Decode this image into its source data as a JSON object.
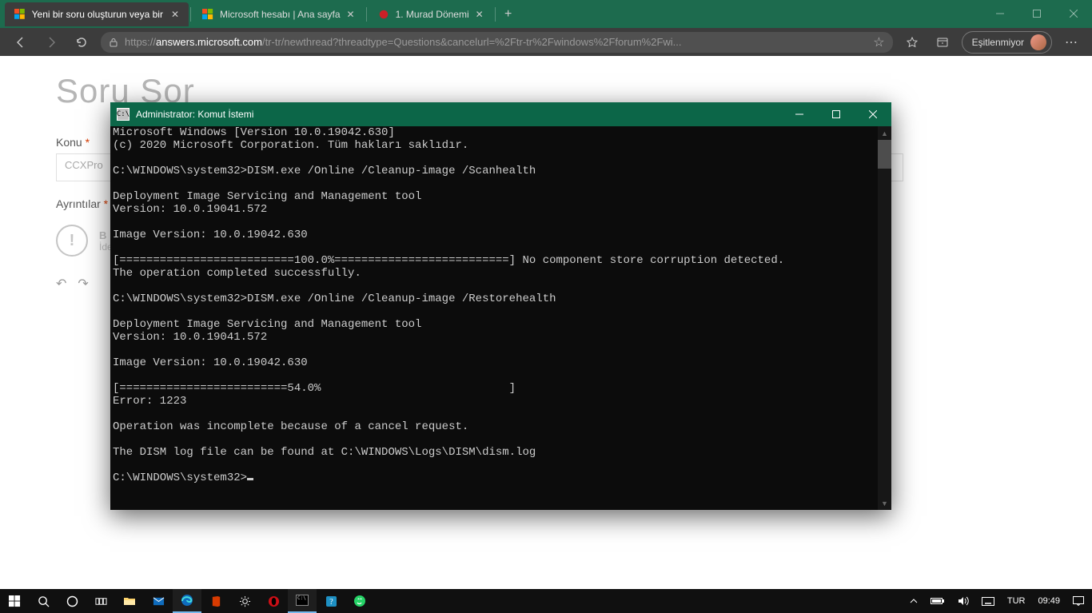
{
  "browser": {
    "tabs": [
      {
        "title": "Yeni bir soru oluşturun veya bir t",
        "favicon": "ms-logo",
        "active": true
      },
      {
        "title": "Microsoft hesabı | Ana sayfa",
        "favicon": "ms-logo",
        "active": false
      },
      {
        "title": "1. Murad Dönemi",
        "favicon": "red-dot",
        "active": false
      }
    ],
    "url_prefix": "https://",
    "url_host": "answers.microsoft.com",
    "url_path": "/tr-tr/newthread?threadtype=Questions&cancelurl=%2Ftr-tr%2Fwindows%2Fforum%2Fwi...",
    "profile_label": "Eşitlenmiyor"
  },
  "page": {
    "heading": "Soru Sor",
    "topic_label": "Konu",
    "topic_placeholder": "CCXPro",
    "details_label": "Ayrıntılar",
    "hint_letter": "B",
    "hint_text": "İde"
  },
  "cmd": {
    "title": "Administrator: Komut İstemi",
    "lines": [
      "Microsoft Windows [Version 10.0.19042.630]",
      "(c) 2020 Microsoft Corporation. Tüm hakları saklıdır.",
      "",
      "C:\\WINDOWS\\system32>DISM.exe /Online /Cleanup-image /Scanhealth",
      "",
      "Deployment Image Servicing and Management tool",
      "Version: 10.0.19041.572",
      "",
      "Image Version: 10.0.19042.630",
      "",
      "[==========================100.0%==========================] No component store corruption detected.",
      "The operation completed successfully.",
      "",
      "C:\\WINDOWS\\system32>DISM.exe /Online /Cleanup-image /Restorehealth",
      "",
      "Deployment Image Servicing and Management tool",
      "Version: 10.0.19041.572",
      "",
      "Image Version: 10.0.19042.630",
      "",
      "[=========================54.0%                            ]",
      "Error: 1223",
      "",
      "Operation was incomplete because of a cancel request.",
      "",
      "The DISM log file can be found at C:\\WINDOWS\\Logs\\DISM\\dism.log",
      "",
      "C:\\WINDOWS\\system32>"
    ]
  },
  "system_tray": {
    "lang": "TUR",
    "time": "09:49"
  }
}
